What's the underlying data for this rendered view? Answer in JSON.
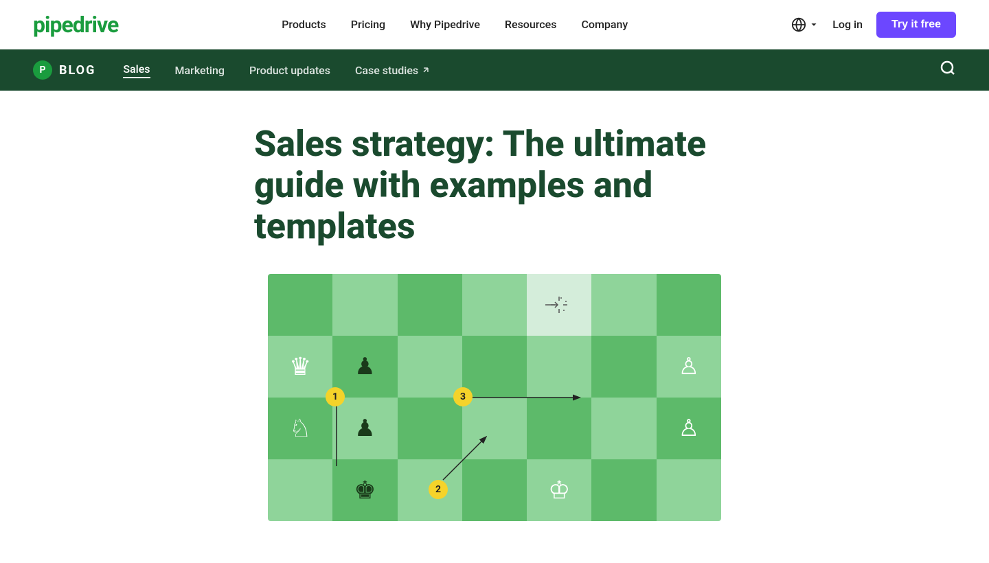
{
  "logo": "pipedrive",
  "nav": {
    "links": [
      "Products",
      "Pricing",
      "Why Pipedrive",
      "Resources",
      "Company"
    ],
    "log_in": "Log in",
    "try_free": "Try it free"
  },
  "blog": {
    "logo_letter": "P",
    "label": "BLOG",
    "tabs": [
      "Sales",
      "Marketing",
      "Product updates",
      "Case studies"
    ],
    "active_tab": "Sales"
  },
  "article": {
    "title": "Sales strategy: The ultimate guide with examples and templates"
  },
  "chess": {
    "badge1": "1",
    "badge2": "2",
    "badge3": "3"
  }
}
